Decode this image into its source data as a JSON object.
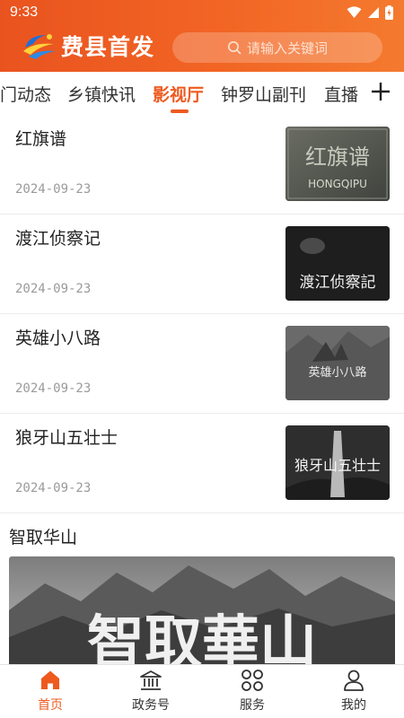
{
  "status_bar": {
    "time": "9:33"
  },
  "header": {
    "app_name": "费县首发",
    "search_placeholder": "请输入关键词"
  },
  "tabs": [
    {
      "label": "门动态"
    },
    {
      "label": "乡镇快讯"
    },
    {
      "label": "影视厅",
      "active": true
    },
    {
      "label": "钟罗山副刊"
    },
    {
      "label": "直播"
    }
  ],
  "items": [
    {
      "title": "红旗谱",
      "date": "2024-09-23",
      "thumb_caption": "红旗谱",
      "thumb_subcaption": "HONGQIPU"
    },
    {
      "title": "渡江侦察记",
      "date": "2024-09-23",
      "thumb_caption": "渡江侦察記"
    },
    {
      "title": "英雄小八路",
      "date": "2024-09-23",
      "thumb_caption": "英雄小八路"
    },
    {
      "title": "狼牙山五壮士",
      "date": "2024-09-23",
      "thumb_caption": "狼牙山五壮士"
    }
  ],
  "feature": {
    "title": "智取华山",
    "image_caption": "智取華山"
  },
  "bottom_nav": [
    {
      "label": "首页",
      "icon": "home-icon",
      "active": true
    },
    {
      "label": "政务号",
      "icon": "government-icon"
    },
    {
      "label": "服务",
      "icon": "services-icon"
    },
    {
      "label": "我的",
      "icon": "profile-icon"
    }
  ],
  "colors": {
    "brand": "#ee5a1e",
    "header_start": "#e9531f",
    "header_end": "#f47a2f"
  }
}
